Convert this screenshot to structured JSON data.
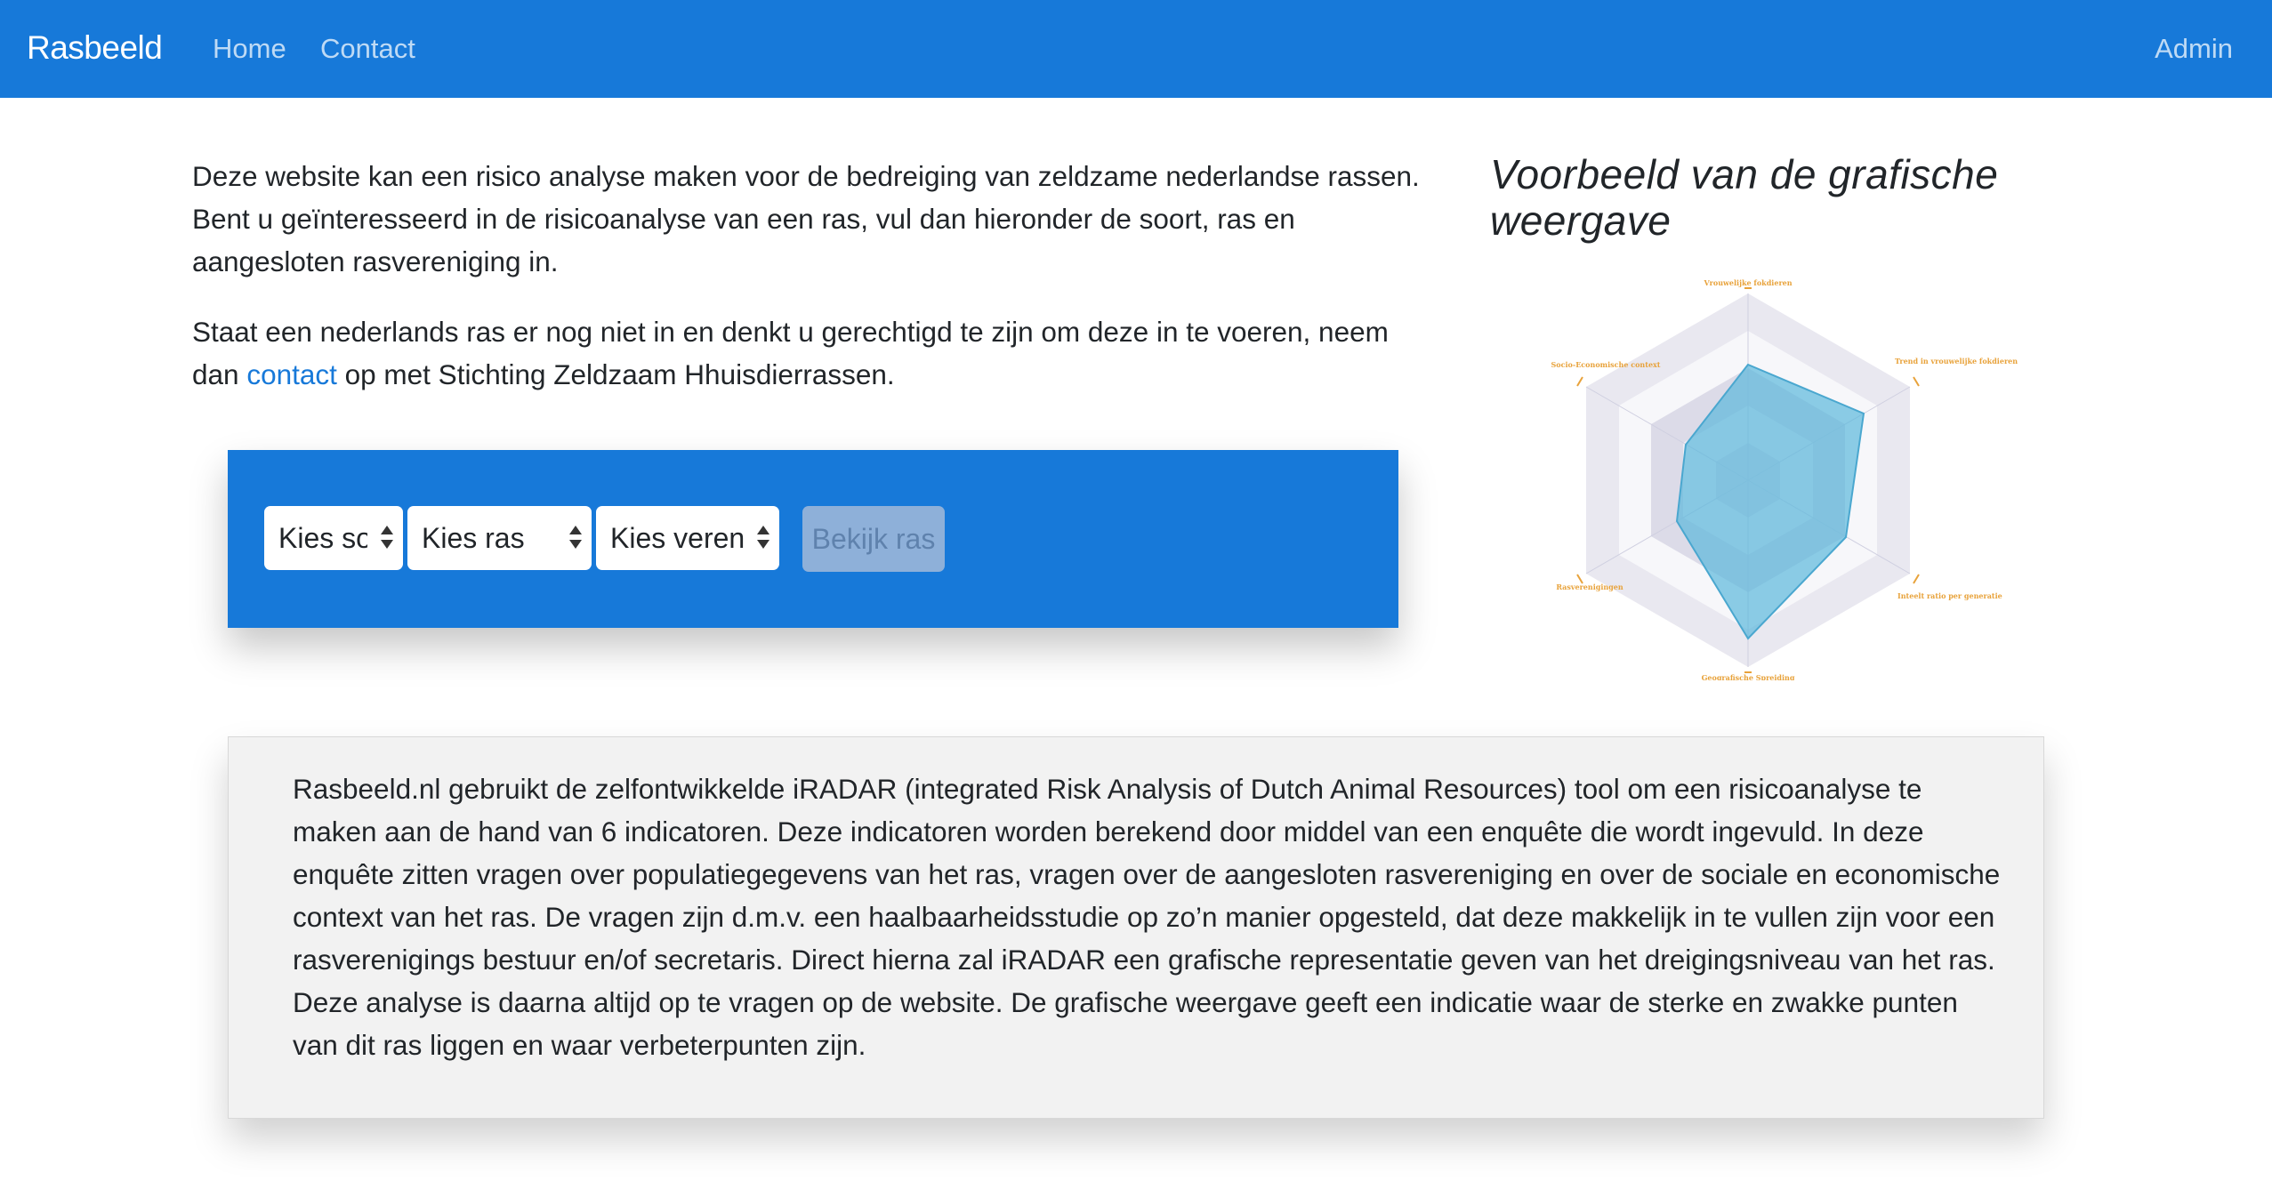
{
  "navbar": {
    "brand": "Rasbeeld",
    "home": "Home",
    "contact": "Contact",
    "admin": "Admin",
    "background_color": "#1779d9"
  },
  "intro": {
    "paragraph1": "Deze website kan een risico analyse maken voor de bedreiging van zeldzame nederlandse rassen. Bent u geïnteresseerd in de risicoanalyse van een ras, vul dan hieronder de soort, ras en aangesloten rasvereniging in.",
    "paragraph2_before": "Staat een nederlands ras er nog niet in en denkt u gerechtigd te zijn om deze in te voeren, neem dan ",
    "paragraph2_link": "contact",
    "paragraph2_after": " op met Stichting Zeldzaam Hhuisdierrassen."
  },
  "form": {
    "select_soort": "Kies soort",
    "select_ras": "Kies ras",
    "select_vereniging": "Kies vereniging",
    "button": "Bekijk ras"
  },
  "example": {
    "title": "Voorbeeld van de grafische weergave",
    "radar_axes": [
      "Vrouwelijke fokdieren",
      "Trend in vrouwelijke fokdieren",
      "Inteelt ratio per generatie",
      "Geografische Spreiding",
      "Rasverenigingen",
      "Socio-Economische context"
    ],
    "fill_color": "#5bb8dc",
    "label_color": "#e8a23a"
  },
  "info": {
    "text": "Rasbeeld.nl gebruikt de zelfontwikkelde iRADAR (integrated Risk Analysis of Dutch Animal Resources) tool om een risicoanalyse te maken aan de hand van 6 indicatoren. Deze indicatoren worden berekend door middel van een enquête die wordt ingevuld. In deze enquête zitten vragen over populatiegegevens van het ras, vragen over de aangesloten rasvereniging en over de sociale en economische context van het ras. De vragen zijn d.m.v. een haalbaarheidsstudie op zo’n manier opgesteld, dat deze makkelijk in te vullen zijn voor een rasverenigings bestuur en/of secretaris. Direct hierna zal iRADAR een grafische representatie geven van het dreigingsniveau van het ras. Deze analyse is daarna altijd op te vragen op de website. De grafische weergave geeft een indicatie waar de sterke en zwakke punten van dit ras liggen en waar verbeterpunten zijn."
  }
}
